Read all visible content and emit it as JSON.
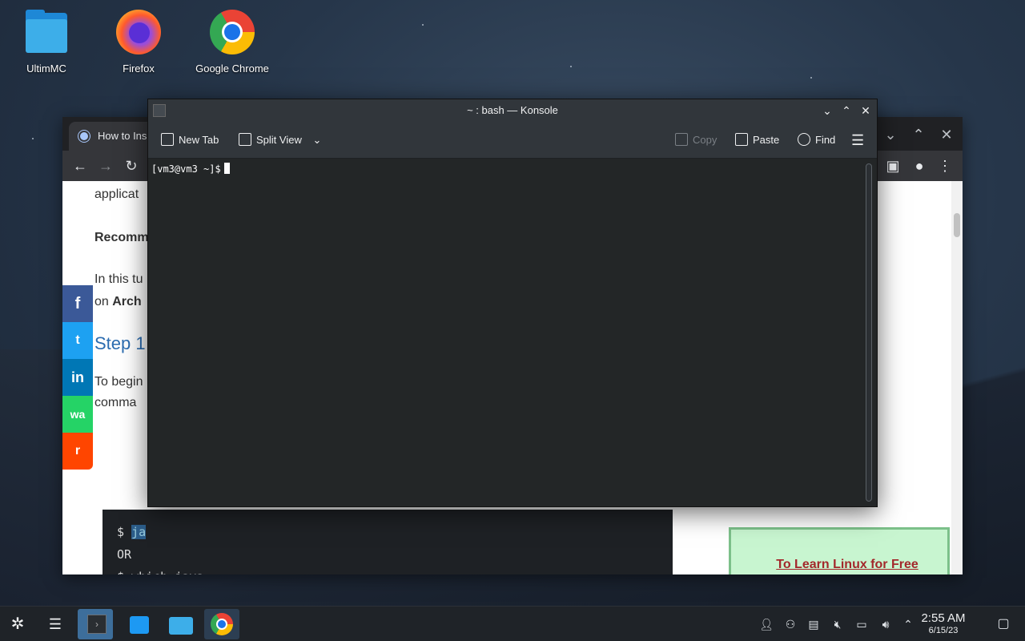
{
  "desktop": {
    "icons": [
      {
        "label": "UltimMC"
      },
      {
        "label": "Firefox"
      },
      {
        "label": "Google Chrome"
      }
    ]
  },
  "chrome_window": {
    "tab_title": "How to Ins",
    "page": {
      "line1": "applicat",
      "line2": "Recomm",
      "line3a": "In this tu",
      "line3b_prefix": "on ",
      "line3b_bold": "Arch",
      "heading": "Step 1",
      "line4a": "To begin",
      "line4b": "comma",
      "code": {
        "line1_prompt": "$ ",
        "line1_highlight": "ja",
        "line2": "OR",
        "line3": "$ which java"
      },
      "share_buttons": [
        "f",
        "t",
        "in",
        "wa",
        "r"
      ],
      "sidebar_link": "To Learn Linux for Free [with Examples]"
    }
  },
  "konsole": {
    "title": "~ : bash — Konsole",
    "toolbar": {
      "new_tab": "New Tab",
      "split_view": "Split View",
      "copy": "Copy",
      "paste": "Paste",
      "find": "Find"
    },
    "prompt": "[vm3@vm3 ~]$"
  },
  "taskbar": {
    "clock_time": "2:55 AM",
    "clock_date": "6/15/23"
  },
  "colors": {
    "konsole_bg": "#232627",
    "taskbar_active": "#3d6e9b",
    "link_color": "#a3282b"
  }
}
